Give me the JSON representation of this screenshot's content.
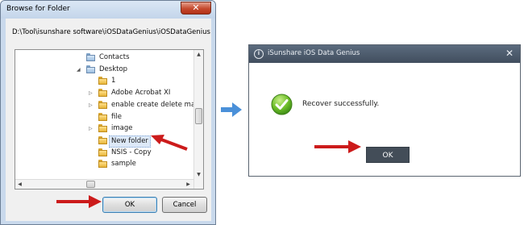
{
  "browse_dialog": {
    "title": "Browse for Folder",
    "close_glyph": "✕",
    "path": "D:\\Tool\\isunshare software\\iOSDataGenius\\iOSDataGenius",
    "tree": {
      "items": [
        {
          "label": "Contacts",
          "icon": "contacts-folder-icon",
          "has_expander": false,
          "expander": ""
        },
        {
          "label": "Desktop",
          "icon": "desktop-folder-icon",
          "has_expander": true,
          "expander": "◢"
        },
        {
          "label": "1",
          "icon": "folder-icon",
          "has_expander": false,
          "expander": ""
        },
        {
          "label": "Adobe Acrobat XI",
          "icon": "folder-icon",
          "has_expander": true,
          "expander": "▷"
        },
        {
          "label": "enable create delete macros",
          "icon": "folder-icon",
          "has_expander": true,
          "expander": "▷"
        },
        {
          "label": "file",
          "icon": "folder-icon",
          "has_expander": false,
          "expander": ""
        },
        {
          "label": "image",
          "icon": "folder-icon",
          "has_expander": true,
          "expander": "▷"
        },
        {
          "label": "New folder",
          "icon": "folder-icon",
          "has_expander": false,
          "expander": "",
          "selected": true
        },
        {
          "label": "NSIS - Copy",
          "icon": "folder-icon",
          "has_expander": false,
          "expander": ""
        },
        {
          "label": "sample",
          "icon": "folder-icon",
          "has_expander": false,
          "expander": ""
        }
      ]
    },
    "scroll_glyphs": {
      "up": "▲",
      "down": "▼",
      "left": "◀",
      "right": "▶"
    },
    "ok_label": "OK",
    "cancel_label": "Cancel"
  },
  "genius_dialog": {
    "title": "iSunshare iOS Data Genius",
    "logo_glyph": "i",
    "close_glyph": "✕",
    "message": "Recover successfully.",
    "ok_label": "OK"
  },
  "annotations": {
    "arrow_color": "#cc1b1b",
    "flow_arrow_color": "#4a90d9"
  }
}
